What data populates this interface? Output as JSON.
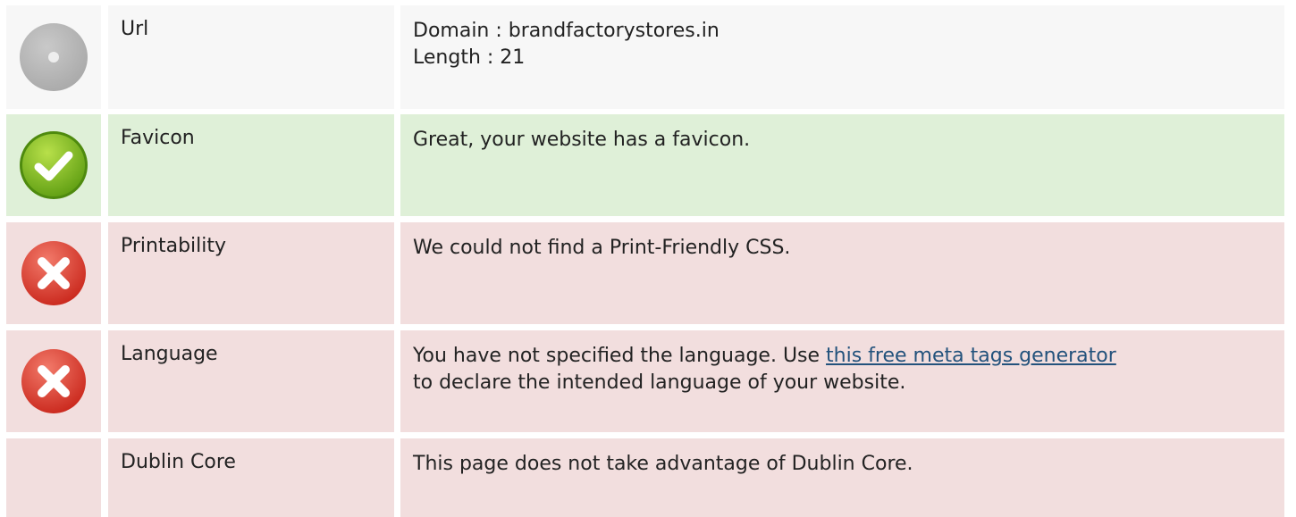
{
  "rows": [
    {
      "status": "neutral",
      "icon": "neutral-dot-icon",
      "name": "Url",
      "lines": [
        "Domain : brandfactorystores.in",
        "Length : 21"
      ]
    },
    {
      "status": "ok",
      "icon": "check-icon",
      "name": "Favicon",
      "lines": [
        "Great, your website has a favicon."
      ]
    },
    {
      "status": "error",
      "icon": "error-x-icon",
      "name": "Printability",
      "lines": [
        "We could not find a Print-Friendly CSS."
      ]
    },
    {
      "status": "error",
      "icon": "error-x-icon",
      "name": "Language",
      "text_before_link": "You have not specified the language. Use ",
      "link_text": "this free meta tags generator",
      "text_after_link": "to declare the intended language of your website."
    },
    {
      "status": "error",
      "icon": "",
      "name": "Dublin Core",
      "lines": [
        "This page does not take advantage of Dublin Core."
      ]
    }
  ],
  "colors": {
    "neutral_bg": "#f7f7f7",
    "ok_bg": "#dff0d8",
    "error_bg": "#f2dede",
    "link": "#23527c"
  }
}
